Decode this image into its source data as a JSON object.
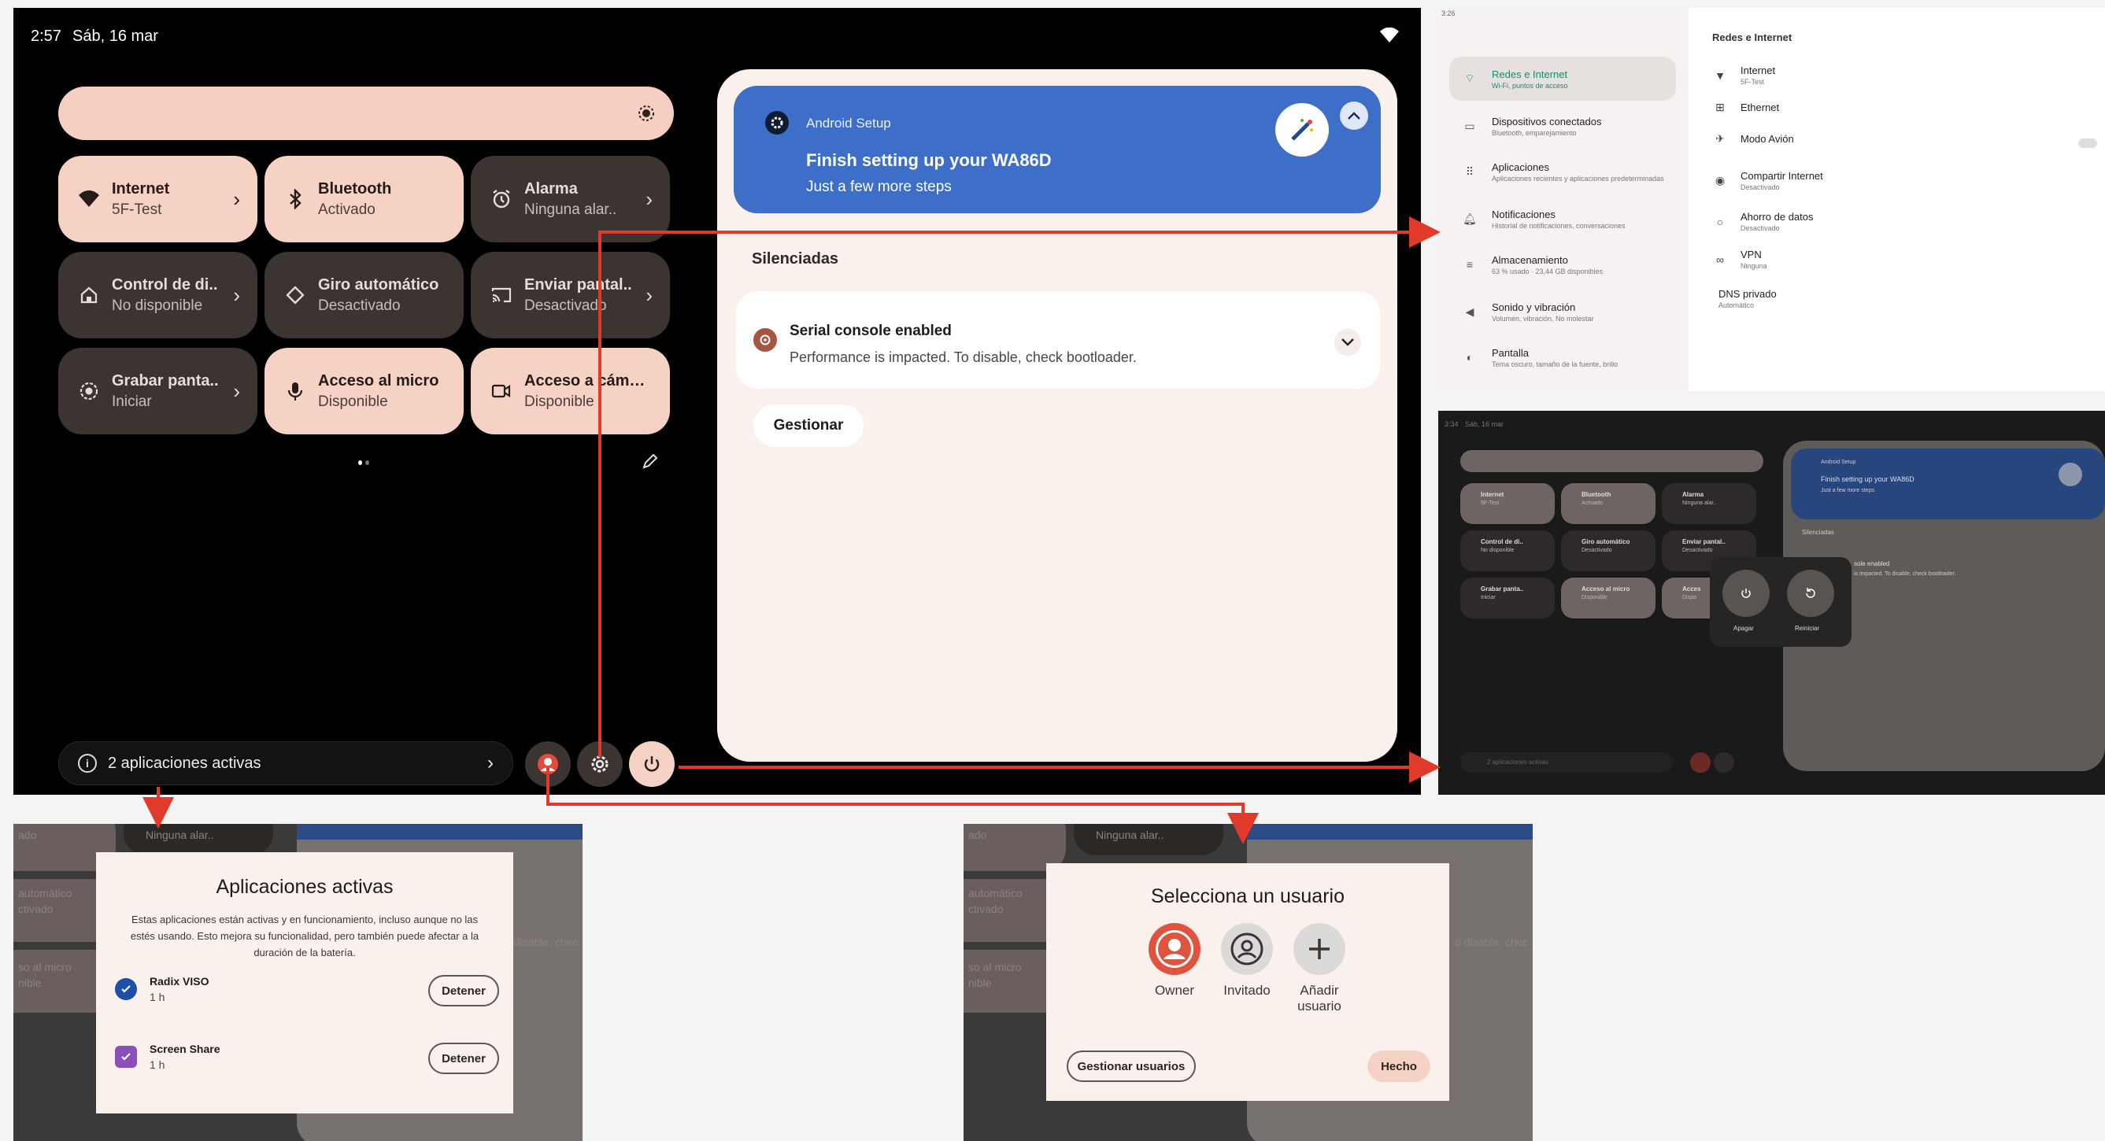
{
  "quick_settings": {
    "time": "2:57",
    "date": "Sáb, 16 mar",
    "tiles": [
      {
        "title": "Internet",
        "subtitle": "5F-Test",
        "icon": "wifi-icon",
        "state": "on"
      },
      {
        "title": "Bluetooth",
        "subtitle": "Activado",
        "icon": "bluetooth-icon",
        "state": "on"
      },
      {
        "title": "Alarma",
        "subtitle": "Ninguna alar..",
        "icon": "alarm-icon",
        "state": "off"
      },
      {
        "title": "Control de di..",
        "subtitle": "No disponible",
        "icon": "home-icon",
        "state": "off"
      },
      {
        "title": "Giro automático",
        "subtitle": "Desactivado",
        "icon": "rotate-icon",
        "state": "off"
      },
      {
        "title": "Enviar pantal..",
        "subtitle": "Desactivado",
        "icon": "cast-icon",
        "state": "off"
      },
      {
        "title": "Grabar panta..",
        "subtitle": "Iniciar",
        "icon": "record-icon",
        "state": "off"
      },
      {
        "title": "Acceso al micro",
        "subtitle": "Disponible",
        "icon": "mic-icon",
        "state": "on"
      },
      {
        "title": "Acceso a cámara",
        "subtitle": "Disponible",
        "icon": "camera-icon",
        "state": "on"
      }
    ],
    "active_apps_label": "2 aplicaciones activas"
  },
  "notifications": {
    "setup": {
      "app": "Android Setup",
      "title": "Finish setting up your WA86D",
      "body": "Just a few more steps"
    },
    "silenced_header": "Silenciadas",
    "serial": {
      "title": "Serial console enabled",
      "body": "Performance is impacted. To disable, check bootloader."
    },
    "manage_label": "Gestionar"
  },
  "settings_panel": {
    "time": "3:26",
    "left_items": [
      {
        "label": "Redes e Internet",
        "sub": "Wi-Fi, puntos de acceso",
        "icon": "wifi-icon",
        "selected": true
      },
      {
        "label": "Dispositivos conectados",
        "sub": "Bluetooth, emparejamiento",
        "icon": "devices-icon",
        "selected": false
      },
      {
        "label": "Aplicaciones",
        "sub": "Aplicaciones recientes y aplicaciones predeterminadas",
        "icon": "apps-icon",
        "selected": false
      },
      {
        "label": "Notificaciones",
        "sub": "Historial de notificaciones, conversaciones",
        "icon": "bell-icon",
        "selected": false
      },
      {
        "label": "Almacenamiento",
        "sub": "63 % usado · 23,44 GB disponibles",
        "icon": "storage-icon",
        "selected": false
      },
      {
        "label": "Sonido y vibración",
        "sub": "Volumen, vibración, No molestar",
        "icon": "sound-icon",
        "selected": false
      },
      {
        "label": "Pantalla",
        "sub": "Tema oscuro, tamaño de la fuente, brillo",
        "icon": "display-icon",
        "selected": false
      }
    ],
    "right_title": "Redes e Internet",
    "right_items": [
      {
        "label": "Internet",
        "sub": "5F-Test",
        "icon": "wifi-icon"
      },
      {
        "label": "Ethernet",
        "sub": "",
        "icon": "ethernet-icon"
      },
      {
        "label": "Modo Avión",
        "sub": "",
        "icon": "airplane-icon"
      },
      {
        "label": "Compartir Internet",
        "sub": "Desactivado",
        "icon": "hotspot-icon"
      },
      {
        "label": "Ahorro de datos",
        "sub": "Desactivado",
        "icon": "data-saver-icon"
      },
      {
        "label": "VPN",
        "sub": "Ninguna",
        "icon": "vpn-icon"
      },
      {
        "label": "DNS privado",
        "sub": "Automático",
        "icon": ""
      }
    ]
  },
  "power_panel": {
    "time": "3:34",
    "date": "Sáb, 16 mar",
    "tiles": [
      {
        "title": "Internet",
        "subtitle": "5F-Test"
      },
      {
        "title": "Bluetooth",
        "subtitle": "Activado"
      },
      {
        "title": "Alarma",
        "subtitle": "Ninguna alar.."
      },
      {
        "title": "Control de di..",
        "subtitle": "No disponible"
      },
      {
        "title": "Giro automático",
        "subtitle": "Desactivado"
      },
      {
        "title": "Enviar pantal..",
        "subtitle": "Desactivado"
      },
      {
        "title": "Grabar panta..",
        "subtitle": "Iniciar"
      },
      {
        "title": "Acceso al micro",
        "subtitle": "Disponible"
      },
      {
        "title": "Acces",
        "subtitle": "Dispo"
      }
    ],
    "setup_app": "Android Setup",
    "setup_title": "Finish setting up your WA86D",
    "setup_body": "Just a few more steps",
    "silenced": "Silenciadas",
    "serial_title": "sole enabled",
    "serial_body": "is impacted. To disable, check bootloader.",
    "power_off": "Apagar",
    "restart": "Reiniciar",
    "active_apps": "2 aplicaciones activas"
  },
  "active_apps_dialog": {
    "bg_text_1": "ado",
    "bg_text_2": "Ninguna alar..",
    "bg_text_3": "automático",
    "bg_text_4": "ctivado",
    "bg_text_5": "so al micro",
    "bg_text_6": "nible",
    "bg_text_7": "o disable, chec",
    "title": "Aplicaciones activas",
    "description": "Estas aplicaciones están activas y en funcionamiento, incluso aunque no las estés usando. Esto mejora su funcionalidad, pero también puede afectar a la duración de la batería.",
    "apps": [
      {
        "name": "Radix VISO",
        "time": "1 h",
        "action": "Detener",
        "color": "#1e4fa8"
      },
      {
        "name": "Screen Share",
        "time": "1 h",
        "action": "Detener",
        "color": "#8a4fb8"
      }
    ]
  },
  "user_dialog": {
    "bg_text_1": "ado",
    "bg_text_2": "Ninguna alar..",
    "bg_text_3": "automático",
    "bg_text_4": "ctivado",
    "bg_text_5": "so al micro",
    "bg_text_6": "nible",
    "bg_text_7": "o disable, chec",
    "title": "Selecciona un usuario",
    "users": [
      {
        "label": "Owner"
      },
      {
        "label": "Invitado"
      },
      {
        "label": "Añadir usuario"
      }
    ],
    "manage_label": "Gestionar usuarios",
    "done_label": "Hecho"
  }
}
